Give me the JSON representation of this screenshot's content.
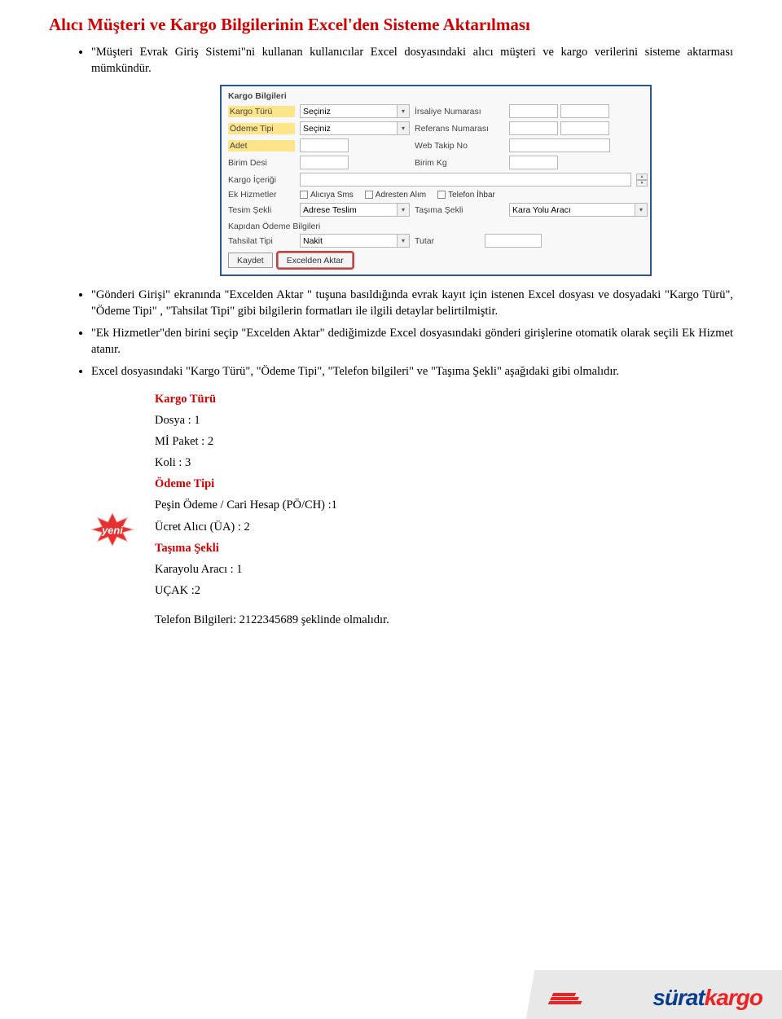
{
  "title": "Alıcı Müşteri ve Kargo Bilgilerinin Excel'den Sisteme Aktarılması",
  "bullets_top": [
    "\"Müşteri Evrak Giriş Sistemi\"ni kullanan kullanıcılar Excel dosyasındaki alıcı müşteri ve kargo verilerini sisteme aktarması mümkündür."
  ],
  "form": {
    "header": "Kargo Bilgileri",
    "labels": {
      "kargo_turu": "Kargo Türü",
      "odeme_tipi": "Ödeme Tipi",
      "adet": "Adet",
      "birim_desi": "Birim Desi",
      "kargo_icerigi": "Kargo İçeriği",
      "ek_hizmetler": "Ek Hizmetler",
      "tesim_sekli": "Tesim Şekli",
      "irsaliye_no": "İrsaliye Numarası",
      "referans_no": "Referans Numarası",
      "web_takip": "Web Takip No",
      "birim_kg": "Birim Kg",
      "tasima_sekli": "Taşıma Şekli",
      "kapidan_odeme": "Kapıdan Ödeme Bilgileri",
      "tahsilat_tipi": "Tahsilat Tipi",
      "tutar": "Tutar"
    },
    "values": {
      "kargo_turu": "Seçiniz",
      "odeme_tipi": "Seçiniz",
      "tesim_sekli": "Adrese Teslim",
      "tasima_sekli": "Kara Yolu Aracı",
      "tahsilat_tipi": "Nakit"
    },
    "checks": {
      "aliciya_sms": "Alıcıya Sms",
      "adresten_alim": "Adresten Alım",
      "telefon_ihbar": "Telefon İhbar"
    },
    "buttons": {
      "kaydet": "Kaydet",
      "excelden_aktar": "Excelden Aktar"
    }
  },
  "bullets_mid": [
    "\"Gönderi Girişi\" ekranında \"Excelden Aktar \" tuşuna basıldığında evrak kayıt için istenen Excel dosyası ve dosyadaki \"Kargo Türü\", \"Ödeme Tipi\" , \"Tahsilat Tipi\" gibi bilgilerin formatları ile ilgili detaylar belirtilmiştir.",
    "\"Ek Hizmetler\"den birini seçip \"Excelden Aktar\" dediğimizde Excel dosyasındaki gönderi girişlerine otomatik olarak seçili Ek Hizmet atanır.",
    "Excel dosyasındaki \"Kargo Türü\", \"Ödeme Tipi\", \"Telefon bilgileri\" ve \"Taşıma Şekli\" aşağıdaki gibi olmalıdır."
  ],
  "defs": {
    "kargo_turu_head": "Kargo Türü",
    "kargo_turu_items": [
      "Dosya : 1",
      "Mİ Paket : 2",
      "Koli : 3"
    ],
    "odeme_tipi_head": "Ödeme Tipi",
    "odeme_tipi_items": [
      "Peşin Ödeme / Cari Hesap (PÖ/CH) :1",
      "Ücret Alıcı (ÜA) : 2"
    ],
    "tasima_sekli_head": "Taşıma Şekli",
    "tasima_sekli_items": [
      "Karayolu Aracı : 1",
      "UÇAK :2"
    ],
    "telefon": "Telefon Bilgileri: 2122345689 şeklinde olmalıdır."
  },
  "badge": {
    "text": "yeni"
  },
  "logo": {
    "part1": "sürat",
    "part2": "kargo"
  }
}
